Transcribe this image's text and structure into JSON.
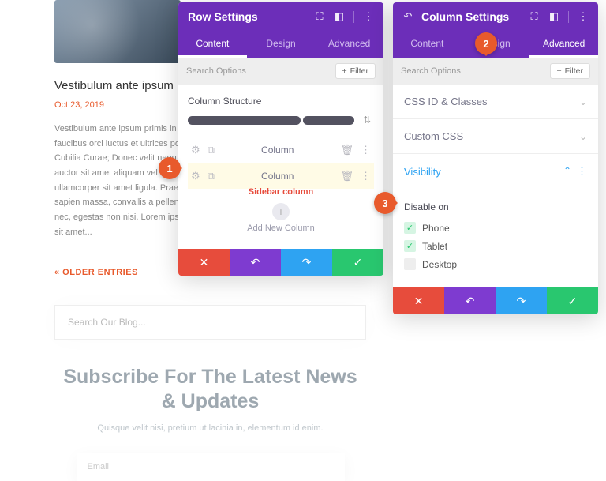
{
  "blog": {
    "title": "Vestibulum ante ipsum primis",
    "date": "Oct 23, 2019",
    "body": "Vestibulum ante ipsum primis in faucibus orci luctus et ultrices pos Cubilia Curae; Donec velit nequ auctor sit amet aliquam vel, ullamcorper sit amet ligula. Prae sapien massa, convallis a pellente nec, egestas non nisi. Lorem ipsu sit amet...",
    "older": "« OLDER ENTRIES",
    "search_placeholder": "Search Our Blog...",
    "subscribe_title": "Subscribe For The Latest News & Updates",
    "subscribe_desc": "Quisque velit nisi, pretium ut lacinia in, elementum id enim.",
    "email_placeholder": "Email"
  },
  "row_panel": {
    "title": "Row Settings",
    "tabs": [
      "Content",
      "Design",
      "Advanced"
    ],
    "active_tab": 0,
    "search": "Search Options",
    "filter": "Filter",
    "section_label": "Column Structure",
    "columns": [
      {
        "label": "Column"
      },
      {
        "label": "Column"
      }
    ],
    "sidebar_annotation": "Sidebar column",
    "add_label": "Add New Column"
  },
  "col_panel": {
    "title": "Column Settings",
    "tabs": [
      "Content",
      "Design",
      "Advanced"
    ],
    "active_tab": 2,
    "search": "Search Options",
    "filter": "Filter",
    "sections": {
      "css_id": "CSS ID & Classes",
      "custom_css": "Custom CSS",
      "visibility": "Visibility"
    },
    "disable_label": "Disable on",
    "options": [
      {
        "label": "Phone",
        "checked": true
      },
      {
        "label": "Tablet",
        "checked": true
      },
      {
        "label": "Desktop",
        "checked": false
      }
    ]
  },
  "callouts": {
    "c1": "1",
    "c2": "2",
    "c3": "3"
  }
}
